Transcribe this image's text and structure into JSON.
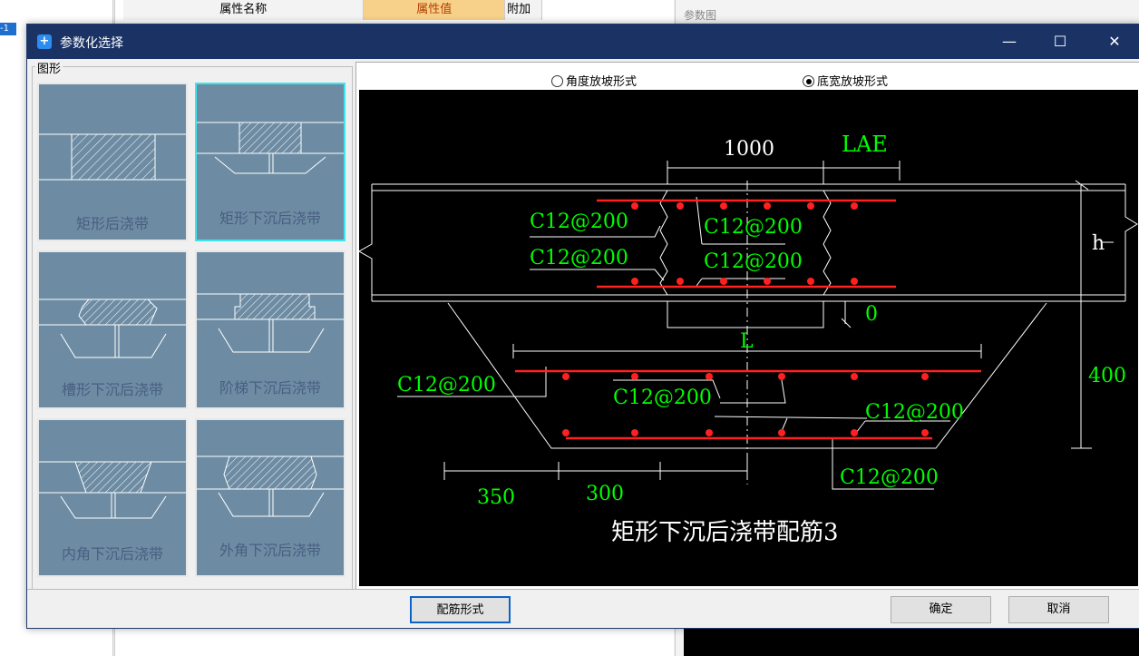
{
  "background": {
    "left_selected": "-1",
    "table_headers": [
      "属性名称",
      "属性值",
      "附加"
    ],
    "right_title": "参数图"
  },
  "dialog": {
    "title": "参数化选择",
    "controls": {
      "minimize": "—",
      "maximize": "☐",
      "close": "✕"
    }
  },
  "shapes": {
    "group_label": "图形",
    "items": [
      {
        "label": "矩形后浇带",
        "selected": false
      },
      {
        "label": "矩形下沉后浇带",
        "selected": true
      },
      {
        "label": "槽形下沉后浇带",
        "selected": false
      },
      {
        "label": "阶梯下沉后浇带",
        "selected": false
      },
      {
        "label": "内角下沉后浇带",
        "selected": false
      },
      {
        "label": "外角下沉后浇带",
        "selected": false
      }
    ]
  },
  "slope_options": [
    {
      "label": "角度放坡形式",
      "selected": false
    },
    {
      "label": "底宽放坡形式",
      "selected": true
    }
  ],
  "drawing": {
    "dims": {
      "top_width": "1000",
      "lae": "LAE",
      "h": "h",
      "zero": "0",
      "L": "L",
      "depth": "400",
      "d350": "350",
      "d300": "300"
    },
    "rebar": {
      "r1": "C12@200",
      "r2": "C12@200",
      "r3": "C12@200",
      "r4": "C12@200",
      "r5": "C12@200",
      "r6": "C12@200",
      "r7": "C12@200",
      "r8": "C12@200"
    },
    "caption": "矩形下沉后浇带配筋3"
  },
  "buttons": {
    "rebar_form": "配筋形式",
    "ok": "确定",
    "cancel": "取消"
  },
  "colors": {
    "titlebar": "#1b3364",
    "thumb_bg": "#6d8ca3",
    "thumb_selected_border": "#3de6ee",
    "rebar_red": "#ff0000",
    "dim_green": "#00ff00"
  }
}
